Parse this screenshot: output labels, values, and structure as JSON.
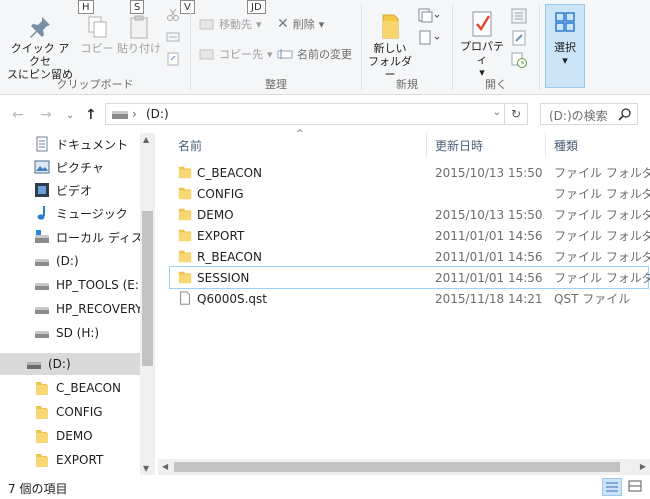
{
  "ribbon": {
    "keytips": [
      "H",
      "S",
      "V",
      "JD"
    ],
    "pin_label_line1": "クイック アクセ",
    "pin_label_line2": "スにピン留め",
    "copy_label": "コピー",
    "paste_label": "貼り付け",
    "clipboard_group": "クリップボード",
    "move_to_label": "移動先",
    "copy_to_label": "コピー先",
    "delete_label": "削除",
    "rename_label": "名前の変更",
    "organize_group": "整理",
    "new_folder_line1": "新しい",
    "new_folder_line2": "フォルダー",
    "new_group": "新規",
    "properties_label": "プロパティ",
    "open_group": "開く",
    "select_label": "選択"
  },
  "address": {
    "path": "(D:)",
    "search_placeholder": "(D:)の検索"
  },
  "nav": {
    "items": [
      {
        "label": "ドキュメント",
        "icon": "documents-icon"
      },
      {
        "label": "ピクチャ",
        "icon": "pictures-icon"
      },
      {
        "label": "ビデオ",
        "icon": "videos-icon"
      },
      {
        "label": "ミュージック",
        "icon": "music-icon"
      },
      {
        "label": "ローカル ディスク (C",
        "icon": "local-disk-icon"
      },
      {
        "label": "(D:)",
        "icon": "drive-icon"
      },
      {
        "label": "HP_TOOLS (E:)",
        "icon": "drive-icon"
      },
      {
        "label": "HP_RECOVERY (",
        "icon": "drive-icon"
      },
      {
        "label": "SD (H:)",
        "icon": "drive-icon"
      }
    ],
    "tree": [
      {
        "label": "(D:)",
        "icon": "drive-icon"
      },
      {
        "label": "C_BEACON",
        "icon": "folder-icon"
      },
      {
        "label": "CONFIG",
        "icon": "folder-icon"
      },
      {
        "label": "DEMO",
        "icon": "folder-icon"
      },
      {
        "label": "EXPORT",
        "icon": "folder-icon"
      }
    ]
  },
  "columns": {
    "name": "名前",
    "date": "更新日時",
    "type": "種類"
  },
  "files": [
    {
      "name": "C_BEACON",
      "date": "2015/10/13 15:50",
      "type": "ファイル フォルダー",
      "icon": "folder-icon"
    },
    {
      "name": "CONFIG",
      "date": "",
      "type": "ファイル フォルダー",
      "icon": "folder-icon"
    },
    {
      "name": "DEMO",
      "date": "2015/10/13 15:50",
      "type": "ファイル フォルダー",
      "icon": "folder-icon"
    },
    {
      "name": "EXPORT",
      "date": "2011/01/01 14:56",
      "type": "ファイル フォルダー",
      "icon": "folder-icon"
    },
    {
      "name": "R_BEACON",
      "date": "2011/01/01 14:56",
      "type": "ファイル フォルダー",
      "icon": "folder-icon"
    },
    {
      "name": "SESSION",
      "date": "2011/01/01 14:56",
      "type": "ファイル フォルダー",
      "icon": "folder-icon"
    },
    {
      "name": "Q6000S.qst",
      "date": "2015/11/18 14:21",
      "type": "QST ファイル",
      "icon": "file-icon"
    }
  ],
  "status": {
    "count": "7 個の項目"
  }
}
